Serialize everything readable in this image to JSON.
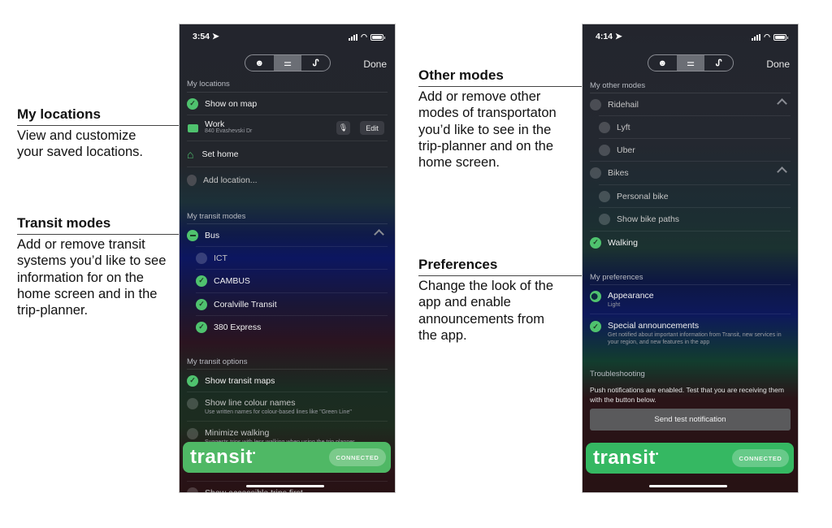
{
  "annotations": {
    "my_locations": {
      "title": "My locations",
      "body": "View and customize your saved locations."
    },
    "transit_modes": {
      "title": "Transit modes",
      "body": "Add or remove transit systems you’d like to see information for on the home screen and in the trip-planner."
    },
    "other_modes": {
      "title": "Other modes",
      "body": "Add or remove other modes of transportaton you’d like to see in the trip-planner and on the home screen."
    },
    "preferences": {
      "title": "Preferences",
      "body": "Change the look of the app and enable announcements from the app."
    }
  },
  "phone1": {
    "time": "3:54",
    "done_label": "Done",
    "tabs": [
      "smiley-icon",
      "sliders-icon",
      "route-icon"
    ],
    "sections": {
      "my_locations": "My locations",
      "my_transit_modes": "My transit modes",
      "my_transit_options": "My transit options"
    },
    "locations": {
      "show_on_map": "Show on map",
      "work_title": "Work",
      "work_address": "840 Evashevski Dr",
      "edit_label": "Edit",
      "set_home": "Set home",
      "add_location": "Add location..."
    },
    "transit_modes": {
      "bus": "Bus",
      "agencies": [
        {
          "name": "ICT",
          "checked": false
        },
        {
          "name": "CAMBUS",
          "checked": true
        },
        {
          "name": "Coralville Transit",
          "checked": true
        },
        {
          "name": "380 Express",
          "checked": true
        }
      ]
    },
    "transit_options": [
      {
        "title": "Show transit maps",
        "subtitle": "",
        "checked": true
      },
      {
        "title": "Show line colour names",
        "subtitle": "Use written names for colour-based lines like \"Green Line\"",
        "checked": false
      },
      {
        "title": "Minimize walking",
        "subtitle": "Suggests trips with less walking when using the trip planner",
        "checked": false
      },
      {
        "title": "Show accessible trips first",
        "subtitle": "",
        "checked": false
      }
    ],
    "banner": {
      "logo": "transit",
      "status": "CONNECTED"
    }
  },
  "phone2": {
    "time": "4:14",
    "done_label": "Done",
    "sections": {
      "my_other_modes": "My other modes",
      "my_preferences": "My preferences",
      "troubleshooting": "Troubleshooting"
    },
    "other_modes": {
      "ridehail": "Ridehail",
      "ridehail_items": [
        "Lyft",
        "Uber"
      ],
      "bikes": "Bikes",
      "bike_items": [
        "Personal bike",
        "Show bike paths"
      ],
      "walking": "Walking"
    },
    "preferences": {
      "appearance_title": "Appearance",
      "appearance_value": "Light",
      "announcements_title": "Special announcements",
      "announcements_desc": "Get notified about important information from Transit, new services in your region, and new features in the app"
    },
    "troubleshooting": {
      "text": "Push notifications are enabled. Test that you are receiving them with the button below.",
      "button": "Send test notification"
    },
    "banner": {
      "logo": "transit",
      "status": "CONNECTED"
    }
  }
}
